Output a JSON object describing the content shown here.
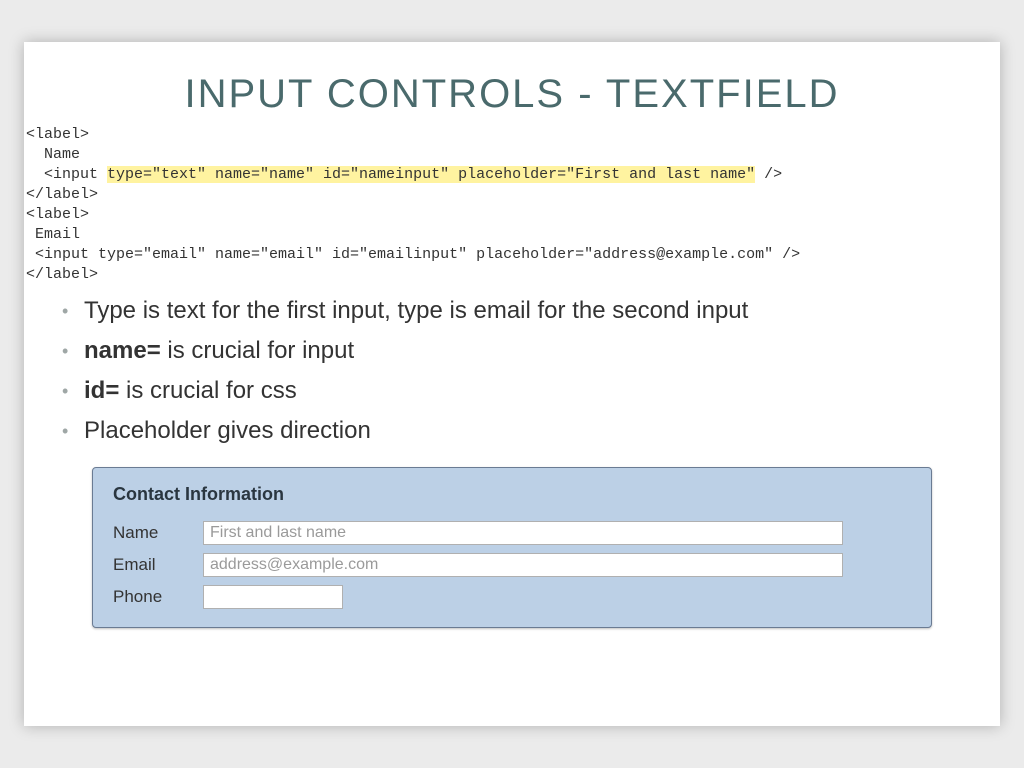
{
  "title": "INPUT CONTROLS - TEXTFIELD",
  "code": {
    "l1": "<label>",
    "l2": "  Name",
    "l3a": "  <input ",
    "l3b": "type=\"text\" name=\"name\" id=\"nameinput\" placeholder=\"First and last name\"",
    "l3c": " />",
    "l4": "</label>",
    "l5": "<label>",
    "l6": " Email",
    "l7": " <input type=\"email\" name=\"email\" id=\"emailinput\" placeholder=\"address@example.com\" />",
    "l8": "</label>"
  },
  "bullets": {
    "b1": "Type is text for the first input, type is email for the second input",
    "b2a": "name=",
    "b2b": " is crucial for input",
    "b3a": "id=",
    "b3b": " is crucial for css",
    "b4": "Placeholder gives direction"
  },
  "form": {
    "title": "Contact Information",
    "name_label": "Name",
    "name_placeholder": "First and last name",
    "email_label": "Email",
    "email_placeholder": "address@example.com",
    "phone_label": "Phone"
  }
}
